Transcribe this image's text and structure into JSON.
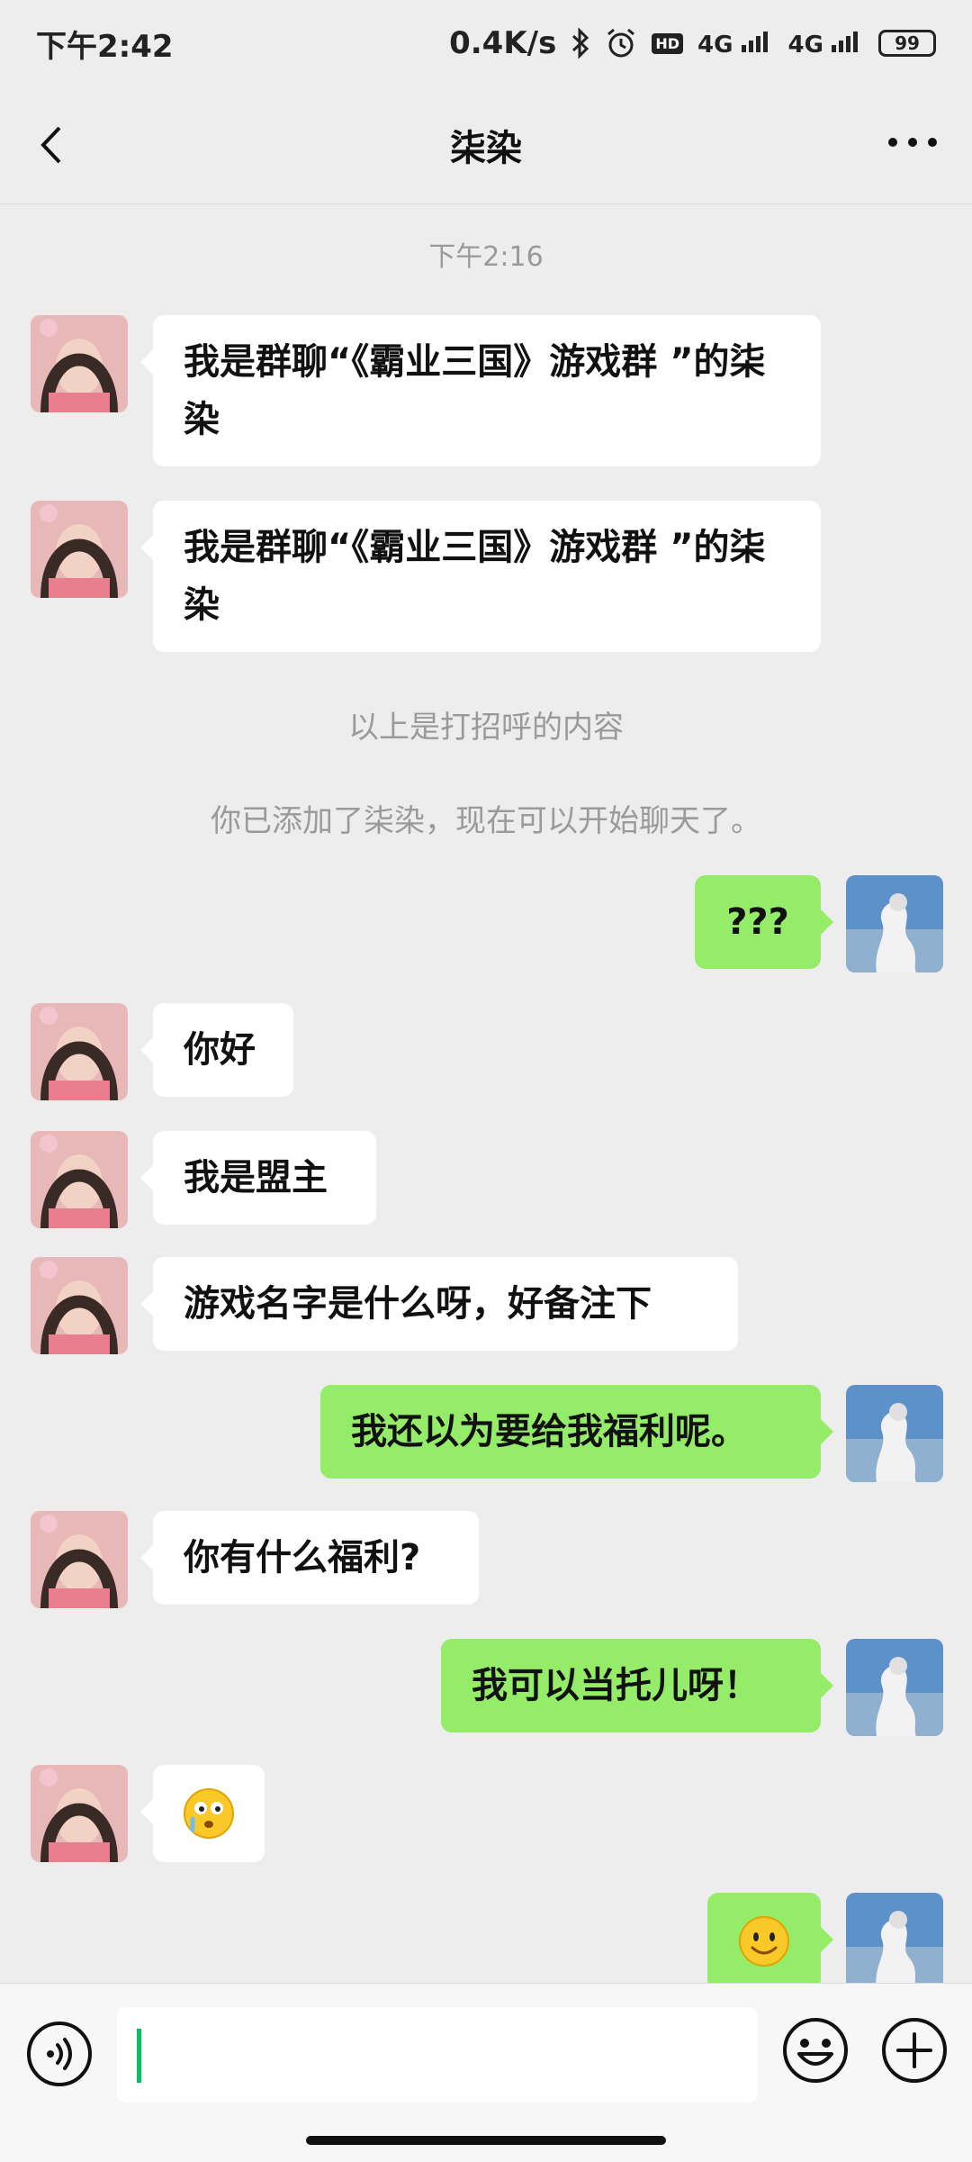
{
  "status_bar": {
    "time": "下午2:42",
    "net_speed": "0.4K/s",
    "signal_1": "4G",
    "signal_2": "4G",
    "hd_label": "HD",
    "battery": "99"
  },
  "header": {
    "title": "柒染"
  },
  "chat": {
    "timestamp": "下午2:16",
    "system_1": "以上是打招呼的内容",
    "system_2": "你已添加了柒染，现在可以开始聊天了。",
    "messages": [
      {
        "side": "in",
        "text": "我是群聊“《霸业三国》游戏群 ”的柒染"
      },
      {
        "side": "in",
        "text": "我是群聊“《霸业三国》游戏群 ”的柒染"
      },
      {
        "side": "out",
        "text": "???"
      },
      {
        "side": "in",
        "text": "你好"
      },
      {
        "side": "in",
        "text": "我是盟主"
      },
      {
        "side": "in",
        "text": "游戏名字是什么呀，好备注下"
      },
      {
        "side": "out",
        "text": "我还以为要给我福利呢。"
      },
      {
        "side": "in",
        "text": "你有什么福利?"
      },
      {
        "side": "out",
        "text": "我可以当托儿呀！"
      },
      {
        "side": "in",
        "emoji": "awkward-emoji"
      },
      {
        "side": "out",
        "emoji": "smile-emoji"
      }
    ]
  },
  "input_bar": {
    "voice_icon": "voice-icon",
    "emoji_icon": "smiley-icon",
    "plus_icon": "plus-icon"
  },
  "colors": {
    "background": "#ededed",
    "outgoing_bubble": "#95ec69",
    "incoming_bubble": "#ffffff",
    "caret": "#07c160"
  }
}
